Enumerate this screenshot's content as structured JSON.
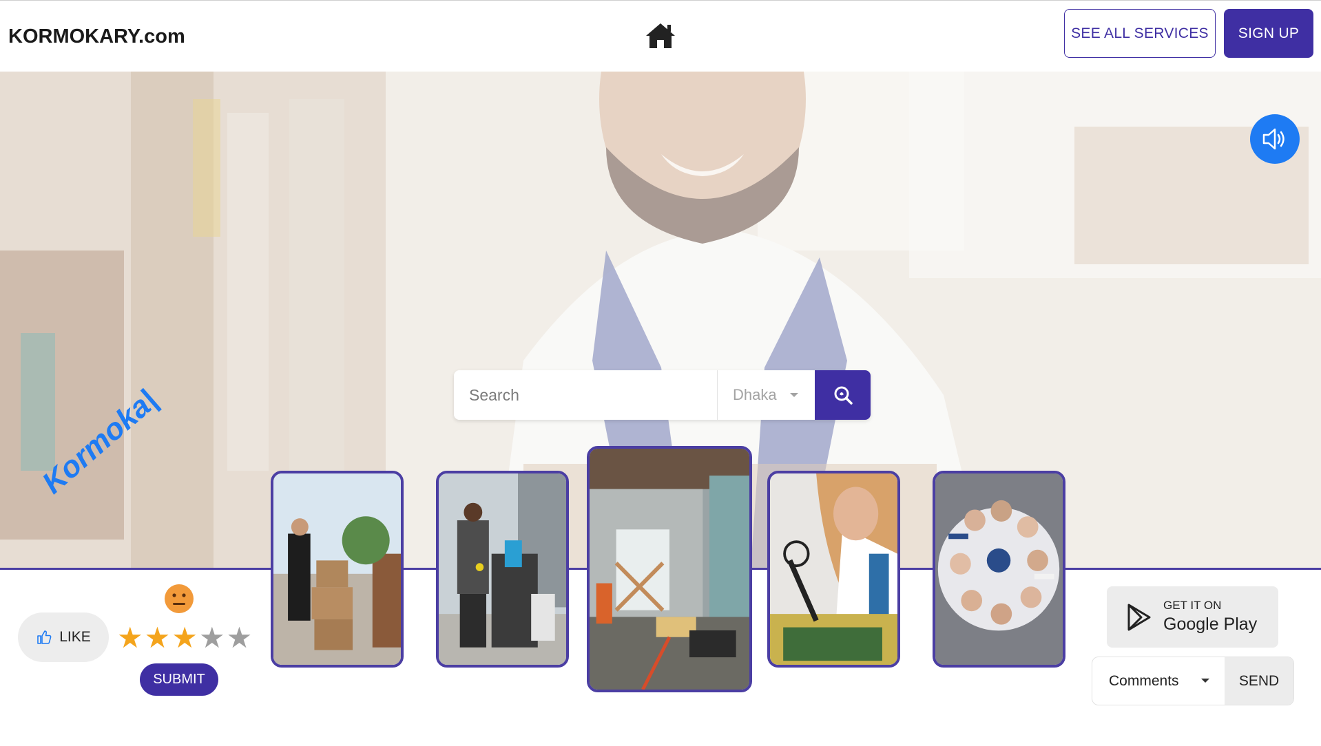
{
  "header": {
    "brand": "KORMOKARY.com",
    "home_icon": "home-icon",
    "see_all_label": "SEE ALL SERVICES",
    "signup_label": "SIGN UP"
  },
  "hero": {
    "sound_icon": "speaker-icon",
    "watermark": "Kormoka|"
  },
  "search": {
    "placeholder": "Search",
    "city": "Dhaka",
    "button_icon": "search-icon"
  },
  "cards": [
    {
      "name": "delivery-worker-card",
      "icon": "photo"
    },
    {
      "name": "cleaning-worker-card",
      "icon": "photo"
    },
    {
      "name": "renovation-card",
      "icon": "photo"
    },
    {
      "name": "electronics-repair-card",
      "icon": "photo"
    },
    {
      "name": "team-card",
      "icon": "photo"
    }
  ],
  "feedback": {
    "like_label": "LIKE",
    "rating": 3,
    "rating_max": 5,
    "submit_label": "SUBMIT"
  },
  "app": {
    "get_it_on": "GET IT ON",
    "store": "Google Play"
  },
  "comments": {
    "select_label": "Comments",
    "send_label": "SEND"
  },
  "colors": {
    "brand_purple": "#3f2fa3",
    "accent_blue": "#1e7bf3",
    "star_on": "#f4a41c",
    "star_off": "#9e9e9e"
  }
}
